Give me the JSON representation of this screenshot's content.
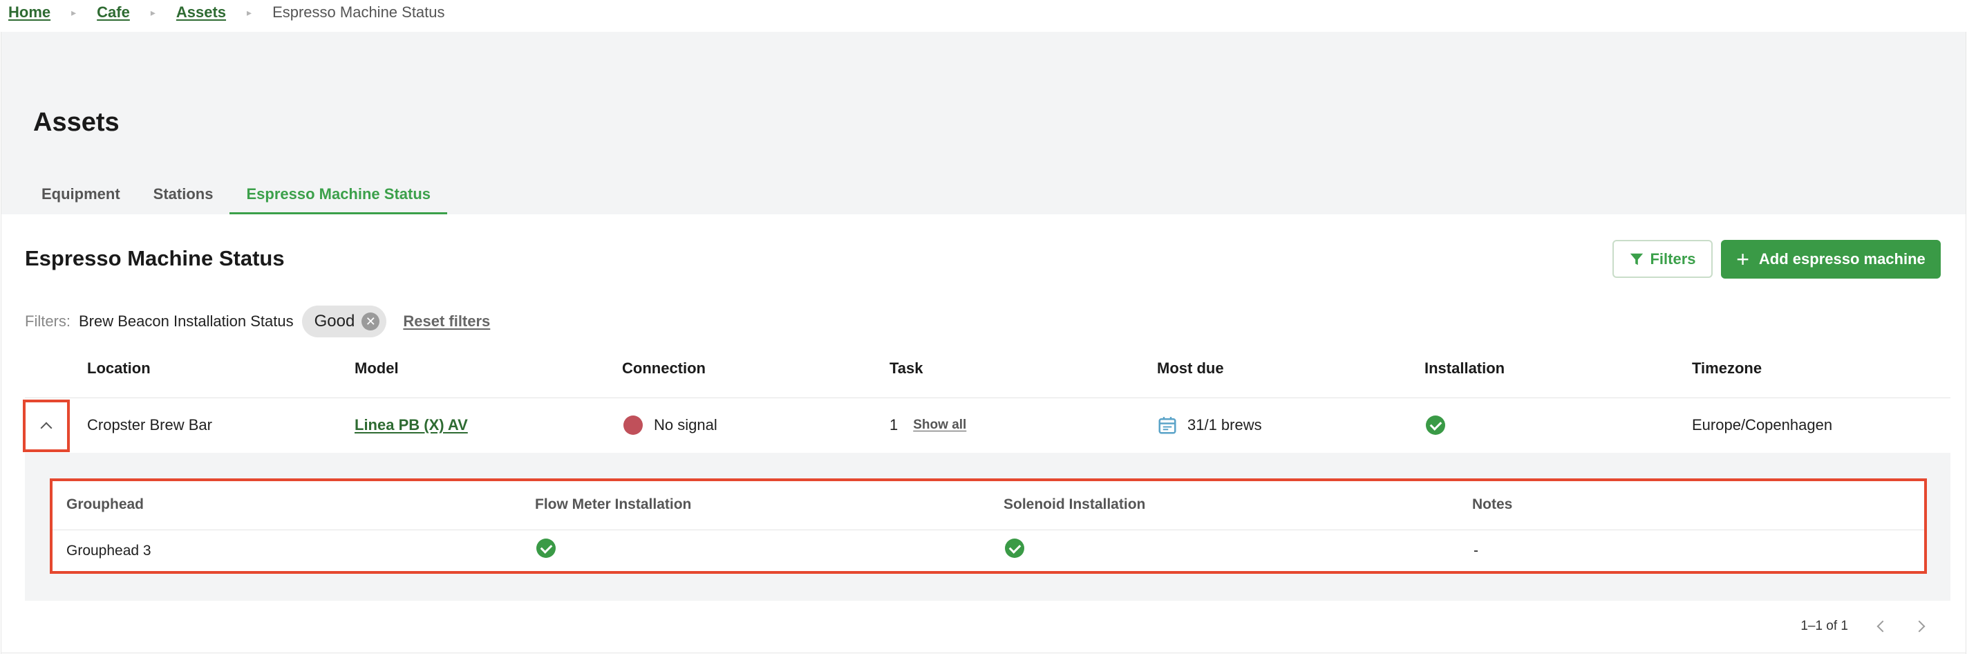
{
  "breadcrumb": {
    "items": [
      "Home",
      "Cafe",
      "Assets"
    ],
    "current": "Espresso Machine Status"
  },
  "page": {
    "title": "Assets"
  },
  "tabs": [
    {
      "label": "Equipment",
      "active": false
    },
    {
      "label": "Stations",
      "active": false
    },
    {
      "label": "Espresso Machine Status",
      "active": true
    }
  ],
  "section": {
    "title": "Espresso Machine Status",
    "filters_button": "Filters",
    "add_button": "Add espresso machine"
  },
  "filters": {
    "label": "Filters:",
    "name": "Brew Beacon Installation Status",
    "chip": "Good",
    "reset": "Reset filters"
  },
  "table": {
    "headers": [
      "Location",
      "Model",
      "Connection",
      "Task",
      "Most due",
      "Installation",
      "Timezone"
    ],
    "row": {
      "location": "Cropster Brew Bar",
      "model": "Linea PB (X) AV",
      "connection": "No signal",
      "task_count": "1",
      "task_link": "Show all",
      "most_due": "31/1 brews",
      "installation_status": "good",
      "timezone": "Europe/Copenhagen"
    }
  },
  "subtable": {
    "headers": [
      "Grouphead",
      "Flow Meter Installation",
      "Solenoid Installation",
      "Notes"
    ],
    "row": {
      "grouphead": "Grouphead 3",
      "flow_meter": "good",
      "solenoid": "good",
      "notes": "-"
    }
  },
  "pagination": {
    "range": "1–1 of 1"
  },
  "colors": {
    "accent": "#3ba04a",
    "primary_button": "#3a9a46",
    "link": "#2e6b32",
    "no_signal": "#c0505a",
    "highlight": "#e5482f"
  },
  "icons": {
    "filters": "filter-icon",
    "add": "plus-icon",
    "chip_remove": "close-circle-icon",
    "expand": "chevron-up-icon",
    "connection": "status-dot-icon",
    "most_due": "calendar-icon",
    "installed": "check-circle-icon",
    "prev": "chevron-left-icon",
    "next": "chevron-right-icon"
  }
}
